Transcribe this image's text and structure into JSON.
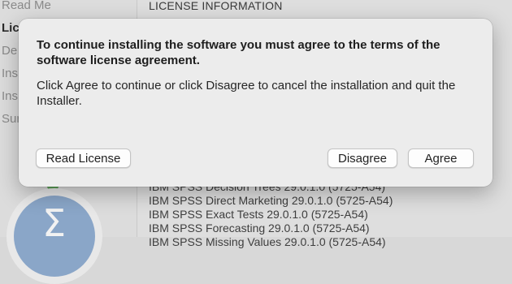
{
  "sidebar": {
    "steps": [
      {
        "label": "Read Me"
      },
      {
        "label": "Lic"
      },
      {
        "label": "De"
      },
      {
        "label": "Ins"
      },
      {
        "label": "Ins"
      },
      {
        "label": "Sur"
      }
    ],
    "logo_icon": "sigma-logo-icon"
  },
  "main": {
    "section_title": "LICENSE INFORMATION",
    "products": [
      "IBM SPSS Decision Trees 29.0.1.0 (5725-A54)",
      "IBM SPSS Direct Marketing 29.0.1.0 (5725-A54)",
      "IBM SPSS Exact Tests 29.0.1.0 (5725-A54)",
      "IBM SPSS Forecasting 29.0.1.0 (5725-A54)",
      "IBM SPSS Missing Values 29.0.1.0 (5725-A54)"
    ]
  },
  "dialog": {
    "heading": "To continue installing the software you must agree to the terms of the software license agreement.",
    "message": "Click Agree to continue or click Disagree to cancel the installation and quit the Installer.",
    "read_license_label": "Read License",
    "disagree_label": "Disagree",
    "agree_label": "Agree"
  },
  "colors": {
    "sheet_background": "#ececec",
    "window_background": "#dedede",
    "logo_blue": "#8aa6c8",
    "status_green": "#5fa45a"
  }
}
